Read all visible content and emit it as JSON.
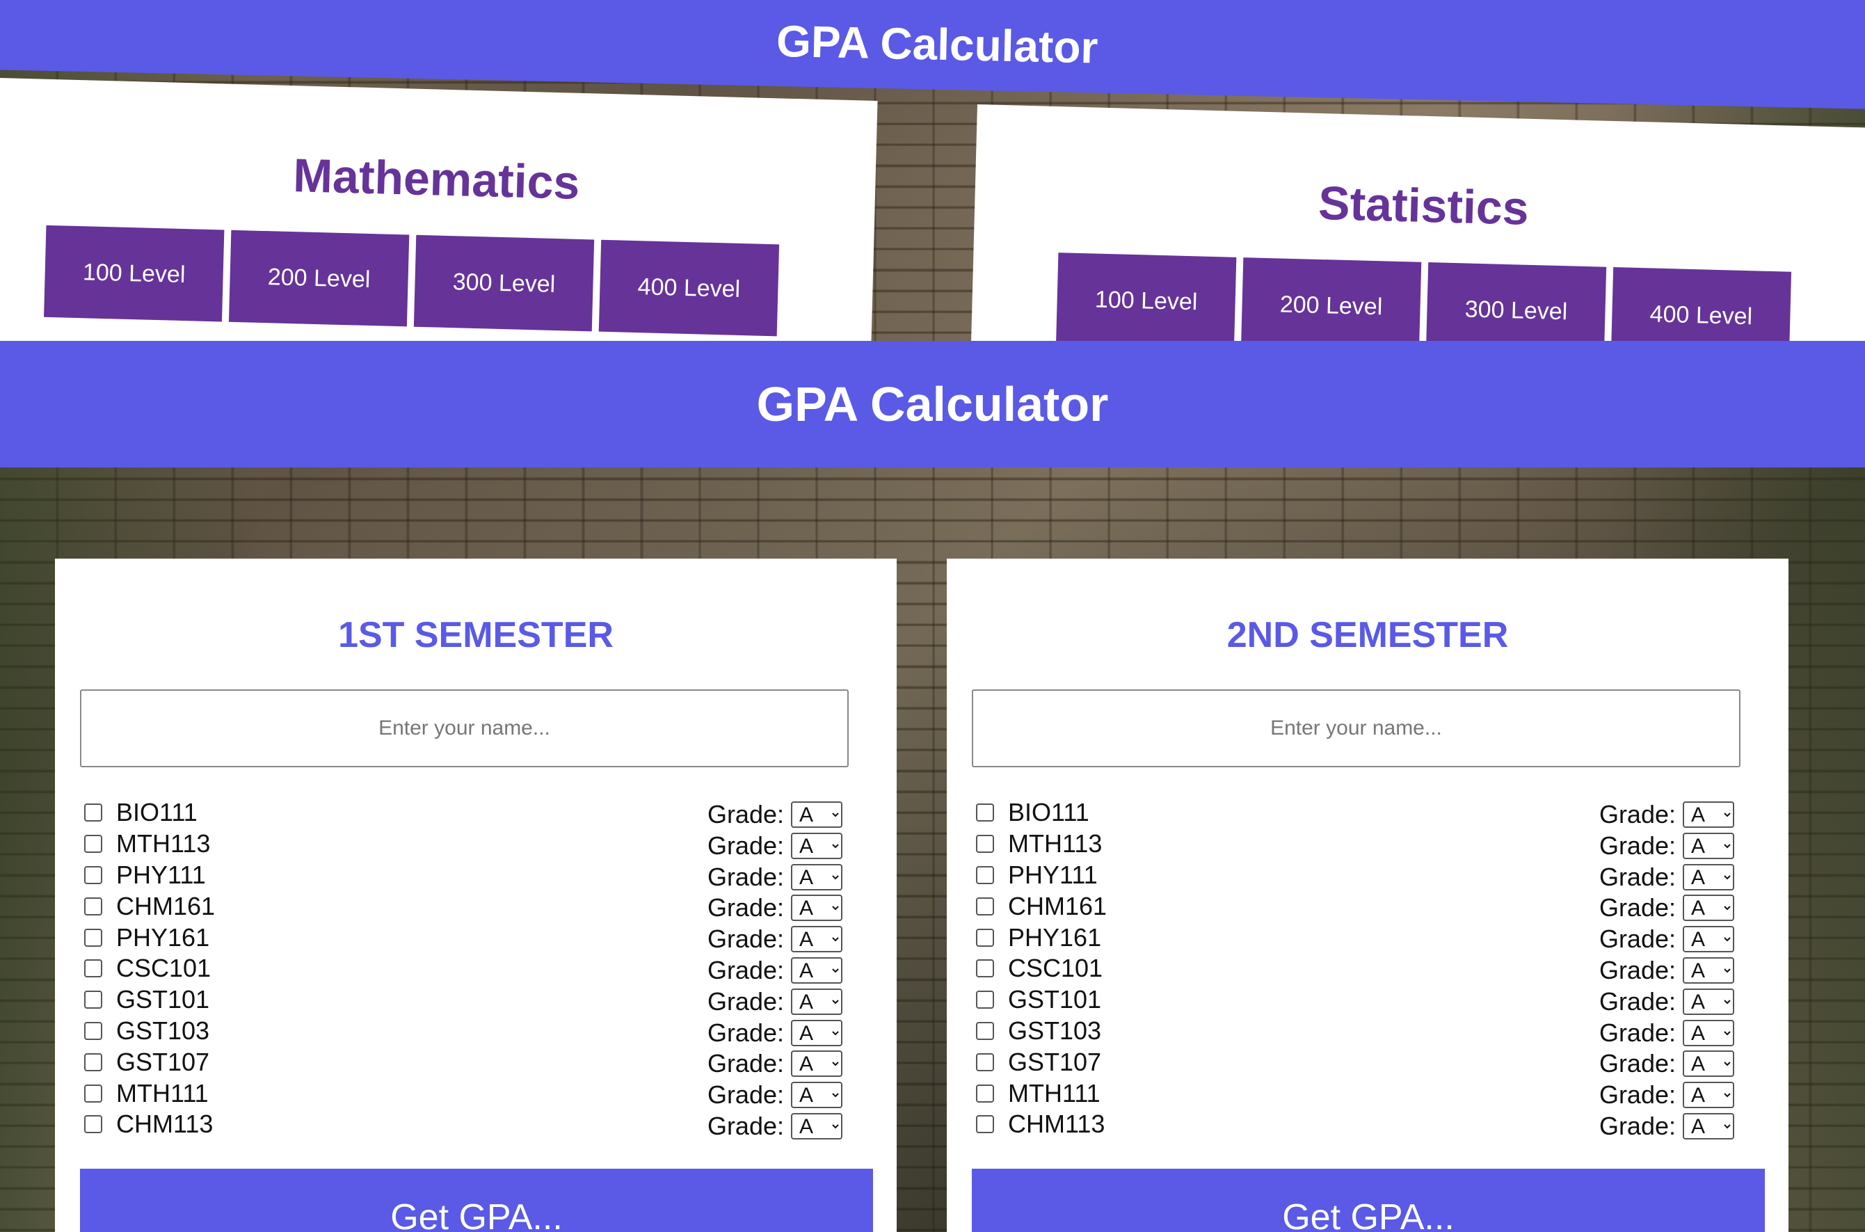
{
  "top_strip": {
    "banner_title": "GPA Calculator",
    "cards": [
      {
        "title": "Mathematics",
        "levels": [
          "100 Level",
          "200 Level",
          "300 Level",
          "400 Level"
        ]
      },
      {
        "title": "Statistics",
        "levels": [
          "100 Level",
          "200 Level",
          "300 Level",
          "400 Level"
        ]
      }
    ]
  },
  "header": {
    "title": "GPA Calculator"
  },
  "semesters": [
    {
      "title": "1ST SEMESTER",
      "name_placeholder": "Enter your name...",
      "grade_label": "Grade:",
      "selected_grade": "A",
      "courses": [
        "BIO111",
        "MTH113",
        "PHY111",
        "CHM161",
        "PHY161",
        "CSC101",
        "GST101",
        "GST103",
        "GST107",
        "MTH111",
        "CHM113"
      ],
      "submit_label": "Get GPA..."
    },
    {
      "title": "2ND SEMESTER",
      "name_placeholder": "Enter your name...",
      "grade_label": "Grade:",
      "selected_grade": "A",
      "courses": [
        "BIO111",
        "MTH113",
        "PHY111",
        "CHM161",
        "PHY161",
        "CSC101",
        "GST101",
        "GST103",
        "GST107",
        "MTH111",
        "CHM113"
      ],
      "submit_label": "Get GPA..."
    }
  ],
  "colors": {
    "header_bg": "#5a5ae6",
    "level_button_bg": "#663399",
    "subject_title": "#663399",
    "semester_title": "#5a5ae6"
  }
}
